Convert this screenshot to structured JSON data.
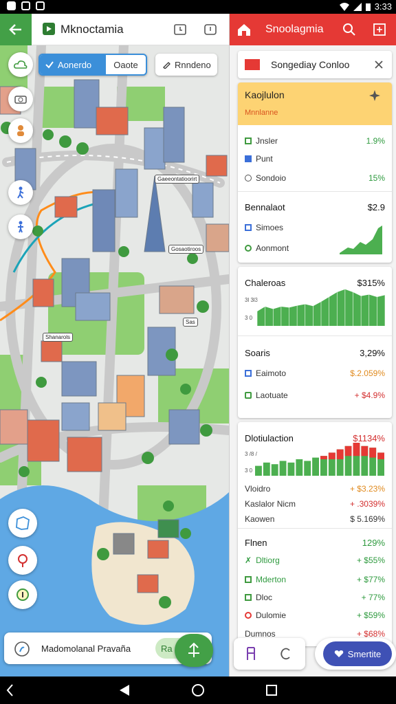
{
  "status": {
    "time": "3:33"
  },
  "left": {
    "title": "Mknoctamia",
    "tab_active": "Aonerdo",
    "tab_inactive": "Oaote",
    "search_label": "Rnndeno",
    "map_labels": [
      "Gaeeontatioorirt",
      "Gosaotiroos",
      "Shanarols",
      "Sas"
    ],
    "bottom_search": "Madomolanal Pravaña",
    "bottom_chip": "Ra"
  },
  "right": {
    "title": "Snoolagmia",
    "search_title": "Songediay Conloo",
    "summary": {
      "title": "Kaojlulon",
      "sub": "Mnnlanne"
    },
    "rows1": [
      {
        "name": "Jnsler",
        "value": "1.9%",
        "icon": "bar-icon",
        "color": "#2e9a3e"
      },
      {
        "name": "Punt",
        "value": "",
        "icon": "grid-icon",
        "color": "#2e9a3e"
      },
      {
        "name": "Sondoio",
        "value": "15%",
        "icon": "eye-icon",
        "color": "#2e9a3e"
      }
    ],
    "block2": {
      "title": "Bennalaot",
      "value": "$2.9",
      "rows": [
        {
          "name": "Simoes"
        },
        {
          "name": "Aonmont"
        }
      ]
    },
    "chart1": {
      "title": "Chaleroas",
      "value": "$315%",
      "ticks": [
        "3l 3l3",
        "3 0"
      ]
    },
    "block3": {
      "title": "Soaris",
      "value": "3,29%",
      "rows": [
        {
          "name": "Eaimoto",
          "value": "$.2.059%"
        },
        {
          "name": "Laotuate",
          "value": "+ $4.9%"
        }
      ]
    },
    "chart2": {
      "title": "Dlotiulaction",
      "value": "$1134%",
      "ticks": [
        "3 /8 /",
        "3 0"
      ]
    },
    "block4": [
      {
        "name": "Vloidro",
        "value": "+ $3.23%"
      },
      {
        "name": "Kaslalor Nicm",
        "value": "+ .3039%"
      },
      {
        "name": "Kaowen",
        "value": "$ 5.169%"
      }
    ],
    "block5": {
      "title": "Flnen",
      "value": "129%",
      "rows": [
        {
          "name": "Dltiorg",
          "value": "+ $55%"
        },
        {
          "name": "Mderton",
          "value": "+ $77%"
        },
        {
          "name": "Dloc",
          "value": "+ 77%"
        },
        {
          "name": "Dulomie",
          "value": "+ $59%"
        }
      ],
      "cut_label": "Dumnos",
      "cut_value": "+ $68%"
    },
    "share_label": "Smertite"
  },
  "chart_data": [
    {
      "type": "area",
      "title": "Chaleroas",
      "values": [
        3,
        4,
        3.5,
        4,
        3.8,
        4.2,
        4.5,
        4.1,
        5,
        6,
        7,
        7.6,
        7,
        6.2,
        6.5,
        6,
        6.4
      ]
    },
    {
      "type": "bar",
      "title": "Dlotiulaction",
      "values": [
        3,
        4,
        3.5,
        4.5,
        4,
        5,
        4.5,
        5.5,
        6,
        7,
        8,
        9,
        10,
        9,
        8.5,
        7
      ],
      "red": [
        0,
        0,
        0,
        0,
        0,
        0,
        0,
        0,
        1,
        2,
        3,
        3,
        4,
        3,
        3,
        2
      ]
    }
  ]
}
